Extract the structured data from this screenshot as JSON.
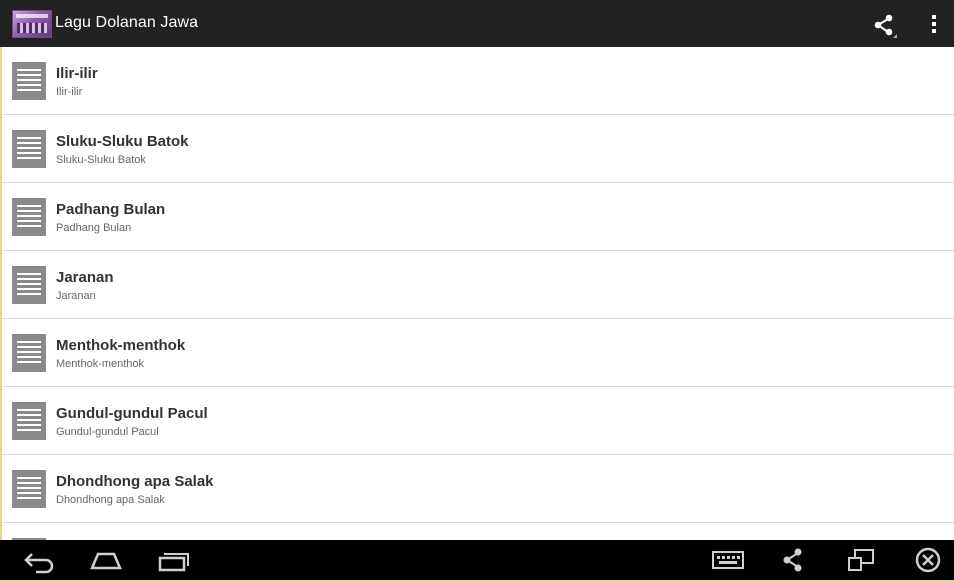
{
  "app": {
    "title": "Lagu Dolanan Jawa",
    "icon": "app-thumbnail",
    "actions": [
      {
        "name": "share-icon"
      },
      {
        "name": "overflow-menu-icon"
      }
    ]
  },
  "songs": [
    {
      "title": "Ilir-ilir",
      "subtitle": "Ilir-ilir",
      "icon": "document-icon"
    },
    {
      "title": "Sluku-Sluku Batok",
      "subtitle": "Sluku-Sluku Batok",
      "icon": "document-icon"
    },
    {
      "title": "Padhang Bulan",
      "subtitle": "Padhang Bulan",
      "icon": "document-icon"
    },
    {
      "title": "Jaranan",
      "subtitle": "Jaranan",
      "icon": "document-icon"
    },
    {
      "title": "Menthok-menthok",
      "subtitle": "Menthok-menthok",
      "icon": "document-icon"
    },
    {
      "title": "Gundul-gundul Pacul",
      "subtitle": "Gundul-gundul Pacul",
      "icon": "document-icon"
    },
    {
      "title": "Dhondhong apa Salak",
      "subtitle": "Dhondhong apa Salak",
      "icon": "document-icon"
    }
  ],
  "navigation_bar": {
    "buttons": [
      "back-icon",
      "home-icon",
      "recent-apps-icon",
      "keyboard-icon",
      "share-icon",
      "screen-mode-icon",
      "close-icon"
    ]
  },
  "colors": {
    "action_bar": "#222222",
    "nav_bar": "#000000",
    "list_background": "#ffffff",
    "divider": "#dcdcdc",
    "row_icon": "#8a8a8a",
    "title_text": "#333333",
    "subtitle_text": "#666666"
  }
}
